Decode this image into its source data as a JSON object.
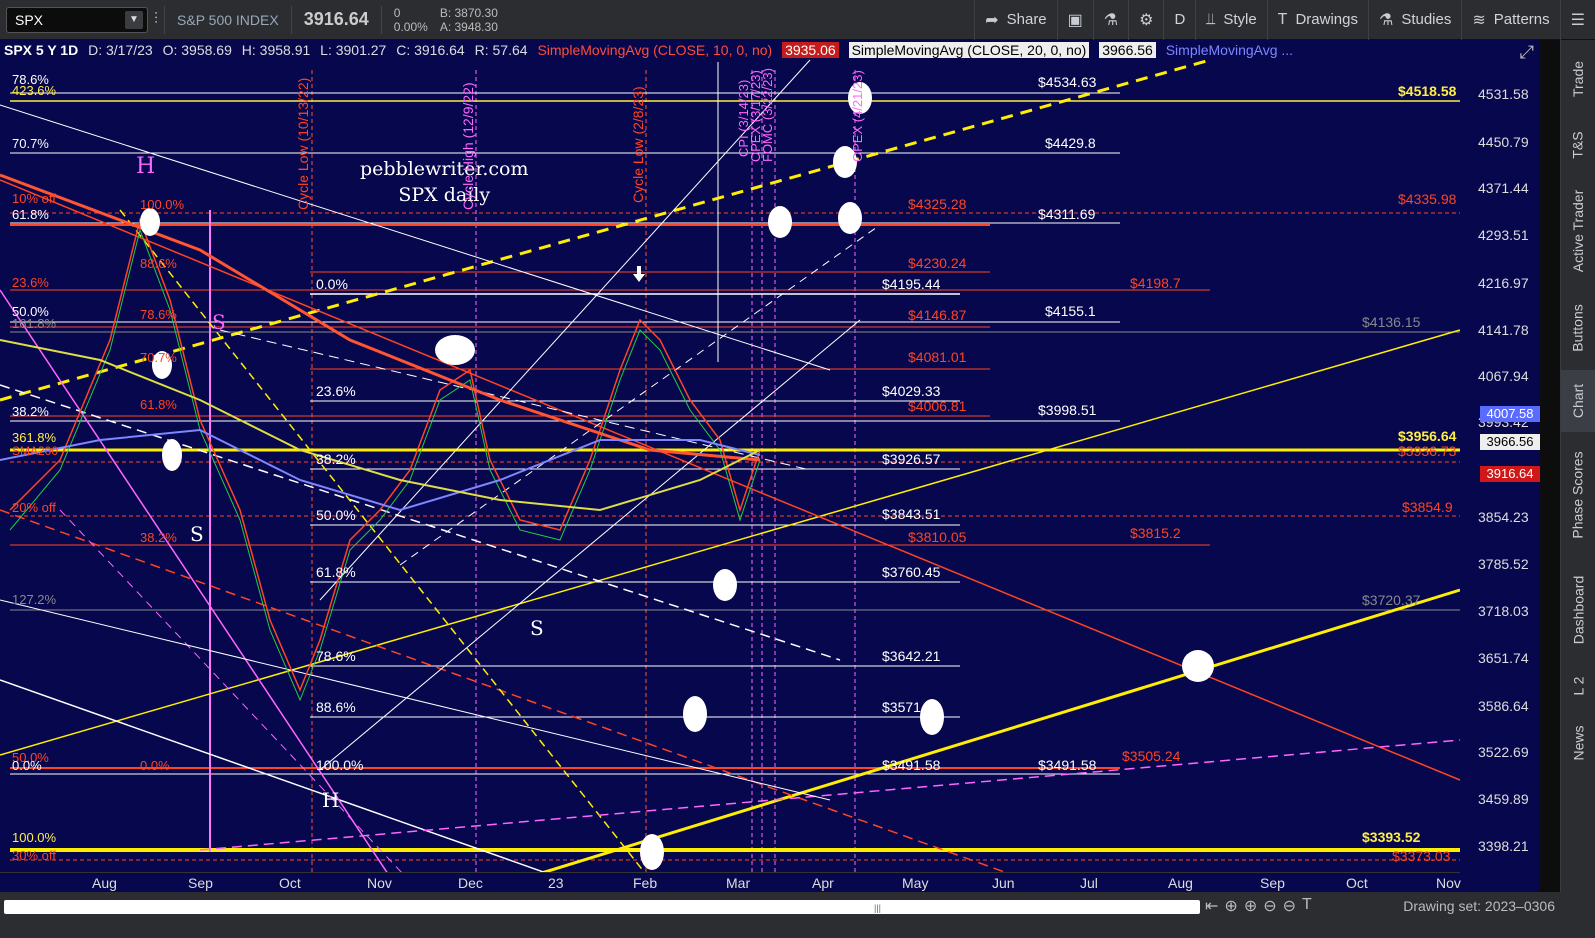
{
  "toolbar": {
    "symbol": "SPX",
    "name": "S&P 500 INDEX",
    "price": "3916.64",
    "change": "0",
    "change_pct": "0.00%",
    "bid": "B: 3870.30",
    "ask": "A: 3948.30",
    "share": "Share",
    "period": "D",
    "style": "Style",
    "drawings": "Drawings",
    "studies": "Studies",
    "patterns": "Patterns"
  },
  "infobar": {
    "symbol": "SPX 5 Y 1D",
    "date": "D: 3/17/23",
    "open": "O: 3958.69",
    "high": "H: 3958.91",
    "low": "L: 3901.27",
    "close": "C: 3916.64",
    "range": "R: 57.64",
    "sma10_label": "SimpleMovingAvg (CLOSE, 10, 0, no)",
    "sma10_value": "3935.06",
    "sma20_label": "SimpleMovingAvg (CLOSE, 20, 0, no)",
    "sma20_value": "3966.56",
    "sma3_label": "SimpleMovingAvg ..."
  },
  "chart_text": {
    "site": "pebblewriter.com",
    "subtitle": "SPX daily",
    "cycle_low_1": "Cycle Low (10/13/22)",
    "cycle_high": "Cycle High (12/9/22)",
    "cycle_low_2": "Cycle Low (2/8/23)",
    "cpi": "CPI (3/14/23)",
    "opex1": "OPEX (3/17/23)",
    "fomc": "FOMC (3/22/23)",
    "opex2": "OPEX (4/21/23)",
    "H1": "H",
    "H2": "H",
    "S1": "S",
    "S2": "S",
    "S3": "S"
  },
  "price_axis": [
    "4531.58",
    "4450.79",
    "4371.44",
    "4293.51",
    "4216.97",
    "4141.78",
    "4067.94",
    "3993.42",
    "3854.23",
    "3785.52",
    "3718.03",
    "3651.74",
    "3586.64",
    "3522.69",
    "3459.89",
    "3398.21"
  ],
  "price_tags": {
    "last": "4007.58",
    "sma": "3966.56",
    "close": "3916.64"
  },
  "time_axis": [
    "Aug",
    "Sep",
    "Oct",
    "Nov",
    "Dec",
    "23",
    "Feb",
    "Mar",
    "Apr",
    "May",
    "Jun",
    "Jul",
    "Aug",
    "Sep",
    "Oct",
    "Nov"
  ],
  "level_labels": {
    "l4534": "$4534.63",
    "l4518": "$4518.58",
    "l4429": "$4429.8",
    "l4325": "$4325.28",
    "l4311": "$4311.69",
    "l4335": "$4335.98",
    "l4230": "$4230.24",
    "l4195": "$4195.44",
    "l4198": "$4198.7",
    "l4155": "$4155.1",
    "l4146": "$4146.87",
    "l4136": "$4136.15",
    "l4081": "$4081.01",
    "l4029": "$4029.33",
    "l4006": "$4006.81",
    "l3998": "$3998.51",
    "l3956": "$3956.64",
    "l3936": "$3936.73",
    "l3926": "$3926.57",
    "l3854": "$3854.9",
    "l3843": "$3843.51",
    "l3815": "$3815.2",
    "l3810": "$3810.05",
    "l3760": "$3760.45",
    "l3720": "$3720.37",
    "l3642": "$3642.21",
    "l3571": "$3571.52",
    "l3505": "$3505.24",
    "l3491a": "$3491.58",
    "l3491b": "$3491.58",
    "l3393": "$3393.52",
    "l3373": "$3373.03"
  },
  "fib_labels": {
    "f786a": "78.6%",
    "f4236": "423.6%",
    "f707": "70.7%",
    "f10off": "10% off",
    "f618a": "61.8%",
    "f236a": "23.6%",
    "f50a": "50.0%",
    "f1618": "161.8%",
    "f382a": "38.2%",
    "f3618": "361.8%",
    "sma200": "SMA200",
    "f20off": "20% off",
    "f1272": "127.2%",
    "f50b": "50.0%",
    "f0a": "0.0%",
    "f0b": "0.0%",
    "f100a": "100.0%",
    "f30off": "30% off",
    "g100": "100.0%",
    "g886": "88.6%",
    "g786": "78.6%",
    "g707": "70.7%",
    "g618": "61.8%",
    "g382": "38.2%",
    "r0": "0.0%",
    "r236": "23.6%",
    "r382": "38.2%",
    "r50": "50.0%",
    "r618": "61.8%",
    "r786": "78.6%",
    "r886": "88.6%",
    "r100": "100.0%"
  },
  "side_tabs": [
    "Trade",
    "T&S",
    "Active Trader",
    "Buttons",
    "Chart",
    "Phase Scores",
    "Dashboard",
    "L 2",
    "News"
  ],
  "drawing_set": "Drawing set: 2023–0306"
}
